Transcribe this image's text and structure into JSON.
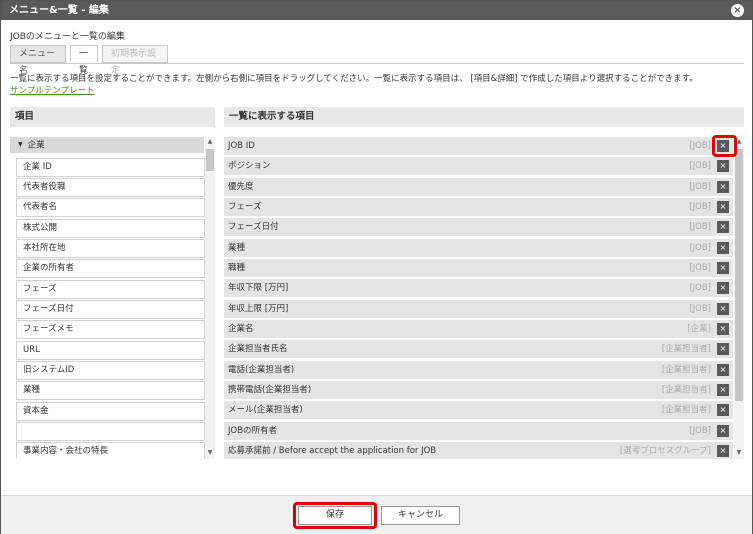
{
  "window": {
    "title": "メニュー&一覧 - 編集",
    "close_label": "×"
  },
  "subtitle": "JOBのメニューと一覧の編集",
  "tabs": [
    {
      "label": "メニュー名"
    },
    {
      "label": "一覧"
    },
    {
      "label": "初期表示設定"
    }
  ],
  "info_text": "一覧に表示する項目を設定することができます。左側から右側に項目をドラッグしてください。一覧に表示する項目は、 [項目&詳細] で作成した項目より選択することができます。",
  "sample_link": "サンプルテンプレート",
  "left_panel": {
    "header": "項目",
    "group_label": "企業",
    "items": [
      "企業 ID",
      "代表者役職",
      "代表者名",
      "株式公開",
      "本社所在地",
      "企業の所有者",
      "フェーズ",
      "フェーズ日付",
      "フェーズメモ",
      "URL",
      "旧システムID",
      "業種",
      "資本金",
      "",
      "事業内容・会社の特長"
    ]
  },
  "right_panel": {
    "header": "一覧に表示する項目",
    "items": [
      {
        "label": "JOB ID",
        "category": "[JOB]"
      },
      {
        "label": "ポジション",
        "category": "[JOB]"
      },
      {
        "label": "優先度",
        "category": "[JOB]"
      },
      {
        "label": "フェーズ",
        "category": "[JOB]"
      },
      {
        "label": "フェーズ日付",
        "category": "[JOB]"
      },
      {
        "label": "業種",
        "category": "[JOB]"
      },
      {
        "label": "職種",
        "category": "[JOB]"
      },
      {
        "label": "年収下限 [万円]",
        "category": "[JOB]"
      },
      {
        "label": "年収上限 [万円]",
        "category": "[JOB]"
      },
      {
        "label": "企業名",
        "category": "[企業]"
      },
      {
        "label": "企業担当者氏名",
        "category": "[企業担当者]"
      },
      {
        "label": "電話(企業担当者)",
        "category": "[企業担当者]"
      },
      {
        "label": "携帯電話(企業担当者)",
        "category": "[企業担当者]"
      },
      {
        "label": "メール(企業担当者)",
        "category": "[企業担当者]"
      },
      {
        "label": "JOBの所有者",
        "category": "[JOB]"
      },
      {
        "label": "応募承諾前 / Before accept the application for JOB",
        "category": "[選考プロセスグループ]"
      }
    ],
    "remove_label": "×"
  },
  "footer": {
    "save_label": "保存",
    "cancel_label": "キャンセル"
  },
  "colors": {
    "title_bar": "#595959",
    "highlight": "#e00000",
    "link": "#4a8a2a"
  }
}
